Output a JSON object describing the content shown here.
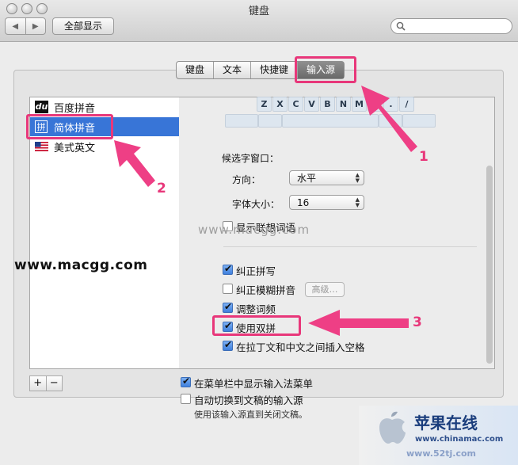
{
  "window": {
    "title": "键盘",
    "show_all": "全部显示"
  },
  "tabs": [
    {
      "label": "键盘"
    },
    {
      "label": "文本"
    },
    {
      "label": "快捷键"
    },
    {
      "label": "输入源"
    }
  ],
  "sources": [
    {
      "label": "百度拼音",
      "icon": "du-icon"
    },
    {
      "label": "简体拼音",
      "icon": "pinyin-icon",
      "selected": true
    },
    {
      "label": "美式英文",
      "icon": "us-flag-icon"
    }
  ],
  "keyboard_preview": {
    "keys": [
      "Z",
      "X",
      "C",
      "V",
      "B",
      "N",
      "M",
      ",",
      ".",
      "/"
    ]
  },
  "candidate_window": {
    "heading": "候选字窗口：",
    "direction_label": "方向：",
    "direction_value": "水平",
    "font_size_label": "字体大小：",
    "font_size_value": "16",
    "show_assoc": {
      "label": "显示联想词语",
      "checked": false
    }
  },
  "options": [
    {
      "label": "纠正拼写",
      "checked": true
    },
    {
      "label": "纠正模糊拼音",
      "checked": false,
      "button": "高级…"
    },
    {
      "label": "调整词频",
      "checked": true
    },
    {
      "label": "使用双拼",
      "checked": true
    },
    {
      "label": "在拉丁文和中文之间插入空格",
      "checked": true
    }
  ],
  "bottom": {
    "add": "+",
    "remove": "−",
    "show_menu": {
      "label": "在菜单栏中显示输入法菜单",
      "checked": true
    },
    "auto_switch": {
      "label": "自动切换到文稿的输入源",
      "checked": false
    },
    "auto_switch_note": "使用该输入源直到关闭文稿。"
  },
  "annotations": {
    "numbers": [
      "1",
      "2",
      "3"
    ],
    "color": "#e8377a",
    "watermark_main": "www.macgg.com",
    "watermark_light": "www.macgg.com"
  },
  "site_logo": {
    "name": "苹果在线",
    "url": "www.chinamac.com",
    "url2": "www.52tj.com"
  },
  "colors": {
    "selection": "#3875d7",
    "accent": "#e8377a"
  }
}
